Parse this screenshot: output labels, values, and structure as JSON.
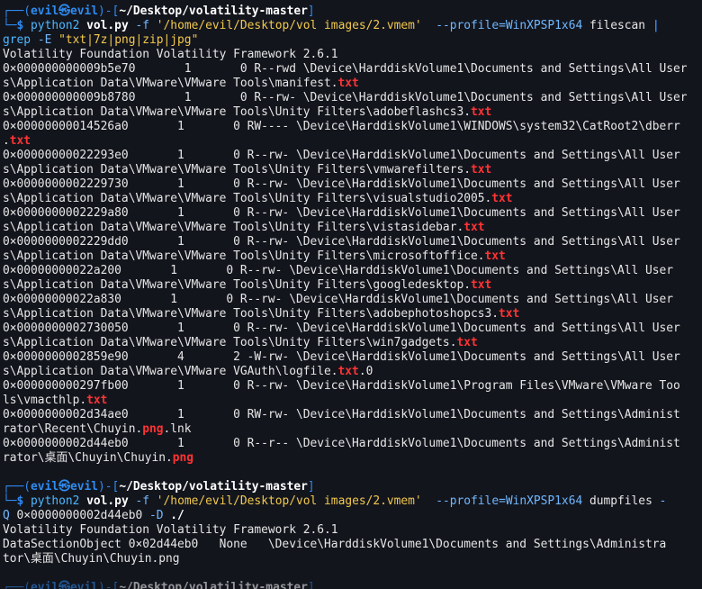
{
  "prompt": {
    "user": "evil",
    "host": "evil",
    "cwd": "~/Desktop/volatility-master"
  },
  "cmd1": {
    "python": "python2",
    "script": "vol.py",
    "flag_f": "-f",
    "image": "'/home/evil/Desktop/vol images/2.vmem'",
    "profile": "--profile=WinXPSP1x64",
    "plugin": "filescan",
    "pipe": "|",
    "grep": "grep",
    "flag_E": "-E",
    "pattern": "\"txt|7z|png|zip|jpg\""
  },
  "banner1": "Volatility Foundation Volatility Framework 2.6.1",
  "results": [
    {
      "pre": "0×000000000009b5e70       1       0 R--rwd \\Device\\HarddiskVolume1\\Documents and Settings\\All User",
      "post": "s\\Application Data\\VMware\\VMware Tools\\manifest.",
      "ext": "txt",
      "tail": ""
    },
    {
      "pre": "0×000000000009b8780       1       0 R--rw- \\Device\\HarddiskVolume1\\Documents and Settings\\All User",
      "post": "s\\Application Data\\VMware\\VMware Tools\\Unity Filters\\adobeflashcs3.",
      "ext": "txt",
      "tail": ""
    },
    {
      "pre": "0×00000000014526a0       1       0 RW---- \\Device\\HarddiskVolume1\\WINDOWS\\system32\\CatRoot2\\dberr",
      "post": ".",
      "ext": "txt",
      "tail": ""
    },
    {
      "pre": "0×00000000022293e0       1       0 R--rw- \\Device\\HarddiskVolume1\\Documents and Settings\\All User",
      "post": "s\\Application Data\\VMware\\VMware Tools\\Unity Filters\\vmwarefilters.",
      "ext": "txt",
      "tail": ""
    },
    {
      "pre": "0×0000000002229730       1       0 R--rw- \\Device\\HarddiskVolume1\\Documents and Settings\\All User",
      "post": "s\\Application Data\\VMware\\VMware Tools\\Unity Filters\\visualstudio2005.",
      "ext": "txt",
      "tail": ""
    },
    {
      "pre": "0×0000000002229a80       1       0 R--rw- \\Device\\HarddiskVolume1\\Documents and Settings\\All User",
      "post": "s\\Application Data\\VMware\\VMware Tools\\Unity Filters\\vistasidebar.",
      "ext": "txt",
      "tail": ""
    },
    {
      "pre": "0×0000000002229dd0       1       0 R--rw- \\Device\\HarddiskVolume1\\Documents and Settings\\All User",
      "post": "s\\Application Data\\VMware\\VMware Tools\\Unity Filters\\microsoftoffice.",
      "ext": "txt",
      "tail": ""
    },
    {
      "pre": "0×00000000022a200       1       0 R--rw- \\Device\\HarddiskVolume1\\Documents and Settings\\All User",
      "post": "s\\Application Data\\VMware\\VMware Tools\\Unity Filters\\googledesktop.",
      "ext": "txt",
      "tail": ""
    },
    {
      "pre": "0×00000000022a830       1       0 R--rw- \\Device\\HarddiskVolume1\\Documents and Settings\\All User",
      "post": "s\\Application Data\\VMware\\VMware Tools\\Unity Filters\\adobephotoshopcs3.",
      "ext": "txt",
      "tail": ""
    },
    {
      "pre": "0×0000000002730050       1       0 R--rw- \\Device\\HarddiskVolume1\\Documents and Settings\\All User",
      "post": "s\\Application Data\\VMware\\VMware Tools\\Unity Filters\\win7gadgets.",
      "ext": "txt",
      "tail": ""
    },
    {
      "pre": "0×0000000002859e90       4       2 -W-rw- \\Device\\HarddiskVolume1\\Documents and Settings\\All User",
      "post": "s\\Application Data\\VMware\\VMware VGAuth\\logfile.",
      "ext": "txt",
      "tail": ".0"
    },
    {
      "pre": "0×000000000297fb00       1       0 R--rw- \\Device\\HarddiskVolume1\\Program Files\\VMware\\VMware Too",
      "post": "ls\\vmacthlp.",
      "ext": "txt",
      "tail": ""
    },
    {
      "pre": "0×0000000002d34ae0       1       0 RW-rw- \\Device\\HarddiskVolume1\\Documents and Settings\\Administ",
      "post": "rator\\Recent\\Chuyin.",
      "ext": "png",
      "tail": ".lnk"
    },
    {
      "pre": "0×0000000002d44eb0       1       0 R--r-- \\Device\\HarddiskVolume1\\Documents and Settings\\Administ",
      "post": "rator\\桌面\\Chuyin\\Chuyin.",
      "ext": "png",
      "tail": ""
    }
  ],
  "cmd2": {
    "python": "python2",
    "script": "vol.py",
    "flag_f": "-f",
    "image": "'/home/evil/Desktop/vol images/2.vmem'",
    "profile": "--profile=WinXPSP1x64",
    "plugin": "dumpfiles",
    "flag_Q": "-",
    "flag_Q2": "Q",
    "offset": "0×0000000002d44eb0",
    "flag_D": "-D",
    "dir": "./"
  },
  "banner2": "Volatility Foundation Volatility Framework 2.6.1",
  "dump_line1": "DataSectionObject 0×02d44eb0   None   \\Device\\HarddiskVolume1\\Documents and Settings\\Administra",
  "dump_line2": "tor\\桌面\\Chuyin\\Chuyin.png",
  "colors": {
    "background": "#13151d",
    "prompt": "#2e8bf0",
    "match": "#ff3333",
    "string": "#f2c94c"
  }
}
